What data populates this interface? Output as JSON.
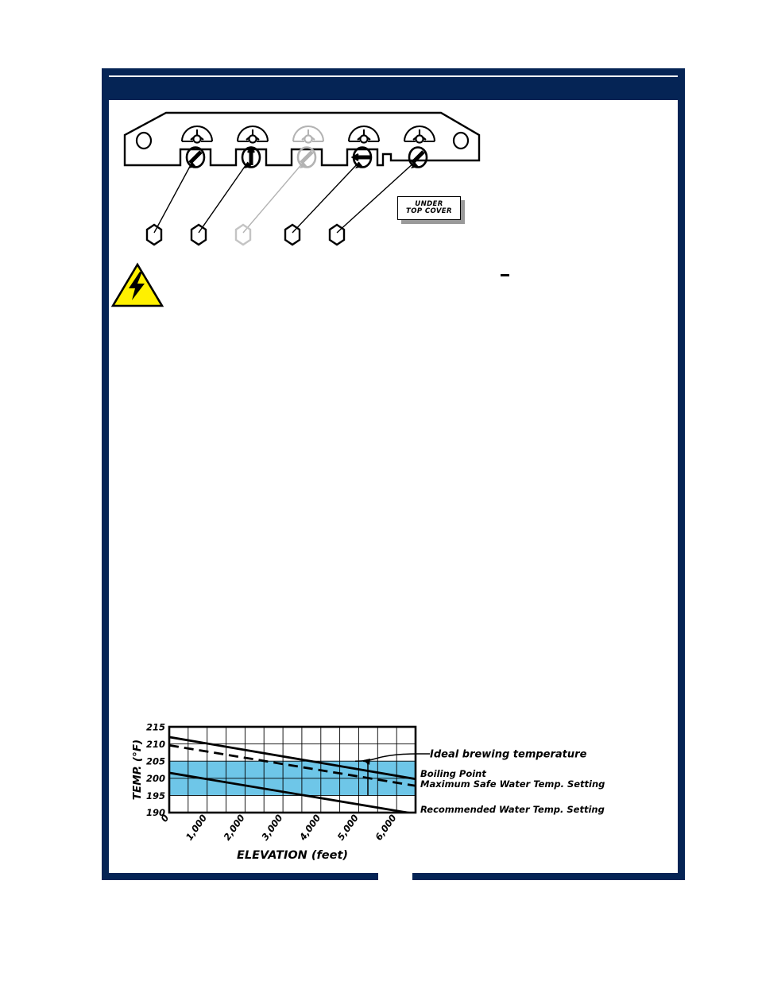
{
  "page": {
    "accent_navy": "#052455",
    "band_blue": "#6EC6E8",
    "hazard_yellow": "#FFF000"
  },
  "diagram": {
    "callout": {
      "line1": "UNDER",
      "line2": "TOP COVER"
    },
    "screws": [
      {
        "id": "screw-1",
        "slot": "diagonal",
        "dimmed": false
      },
      {
        "id": "screw-2",
        "slot": "vertical",
        "dimmed": false
      },
      {
        "id": "screw-3",
        "slot": "diagonal",
        "dimmed": true
      },
      {
        "id": "screw-4",
        "slot": "horizontal",
        "dimmed": false
      },
      {
        "id": "screw-5",
        "slot": "diagonal",
        "dimmed": false
      }
    ],
    "nuts": [
      {
        "id": "nut-1",
        "dimmed": false
      },
      {
        "id": "nut-2",
        "dimmed": false
      },
      {
        "id": "nut-3",
        "dimmed": true
      },
      {
        "id": "nut-4",
        "dimmed": false
      },
      {
        "id": "nut-5",
        "dimmed": false
      }
    ],
    "hazard_icon": "high-voltage-icon"
  },
  "chart_data": {
    "type": "line",
    "title": "",
    "xlabel": "ELEVATION (feet)",
    "ylabel": "TEMP. (°F)",
    "xlim": [
      0,
      6500
    ],
    "ylim": [
      190,
      215
    ],
    "xticks": [
      0,
      1000,
      2000,
      3000,
      4000,
      5000,
      6000
    ],
    "xticklabels": [
      "0",
      "1,000",
      "2,000",
      "3,000",
      "4,000",
      "5,000",
      "6,000"
    ],
    "yticks": [
      190,
      195,
      200,
      205,
      210,
      215
    ],
    "yticklabels": [
      "190",
      "195",
      "200",
      "205",
      "210",
      "215"
    ],
    "grid": true,
    "grid_x_step": 500,
    "grid_y_step": 5,
    "shaded_band": {
      "label": "Ideal brewing temperature",
      "from": 195,
      "to": 205,
      "color": "#6EC6E8"
    },
    "legend_position": "right",
    "series": [
      {
        "name": "Boiling Point",
        "style": "solid",
        "x": [
          0,
          6500
        ],
        "values": [
          212.0,
          199.8
        ]
      },
      {
        "name": "Maximum Safe Water Temp. Setting",
        "style": "dashed",
        "x": [
          0,
          6500
        ],
        "values": [
          209.6,
          197.8
        ]
      },
      {
        "name": "Recommended Water Temp. Setting",
        "style": "solid",
        "x": [
          0,
          6500
        ],
        "values": [
          201.6,
          189.6
        ]
      }
    ],
    "annotations": [
      {
        "text": "Ideal brewing temperature",
        "target_x": 5300,
        "target_y": 205
      },
      {
        "text": "Boiling Point",
        "target_x": 6500,
        "target_y": 199.8
      },
      {
        "text": "Maximum Safe Water Temp. Setting",
        "target_x": 6500,
        "target_y": 197.8
      },
      {
        "text": "Recommended Water Temp. Setting",
        "target_x": 6500,
        "target_y": 189.6
      }
    ]
  }
}
